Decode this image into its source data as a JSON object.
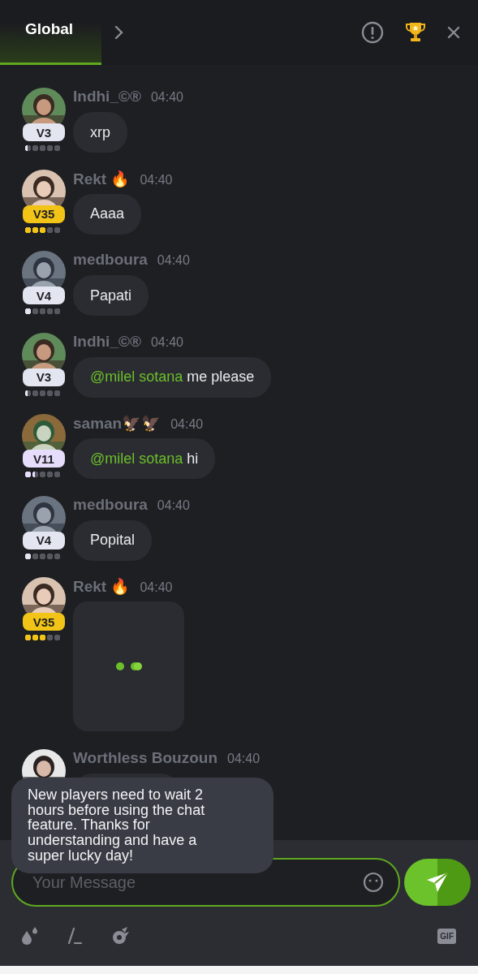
{
  "header": {
    "tab": {
      "label": "Global",
      "selected": true
    }
  },
  "messages": [
    {
      "kind": "text",
      "user": "Indhi_©®",
      "time": "04:40",
      "vip": "V3",
      "color": "#e3e5f0",
      "level": 0.1,
      "text": "xrp"
    },
    {
      "kind": "text",
      "user": "Rekt 🔥",
      "time": "04:40",
      "vip": "V35",
      "color": "#f2c417",
      "level": 0.6,
      "text": "Aaaa"
    },
    {
      "kind": "text",
      "user": "medboura",
      "time": "04:40",
      "vip": "V4",
      "color": "#e3e5f0",
      "level": 0.2,
      "text": "Papati"
    },
    {
      "kind": "text",
      "user": "Indhi_©®",
      "time": "04:40",
      "vip": "V3",
      "color": "#e3e5f0",
      "level": 0.1,
      "mention": "@milel sotana",
      "text": "me please"
    },
    {
      "kind": "text",
      "user": "saman🦅🦅",
      "time": "04:40",
      "vip": "V11",
      "color": "#e6dcfb",
      "level": 0.3,
      "mention": "@milel sotana",
      "text": "hi"
    },
    {
      "kind": "text",
      "user": "medboura",
      "time": "04:40",
      "vip": "V4",
      "color": "#e3e5f0",
      "level": 0.2,
      "text": "Popital"
    },
    {
      "kind": "loading",
      "user": "Rekt 🔥",
      "time": "04:40",
      "vip": "V35",
      "color": "#f2c417",
      "level": 0.6
    },
    {
      "kind": "covered",
      "user": "Worthless Bouzoun",
      "time": "04:40"
    }
  ],
  "notice": {
    "text": "New players need to wait 2 hours before using the chat feature. Thanks for understanding and have a super lucky day!"
  },
  "composer": {
    "placeholder": "Your Message"
  },
  "toolbar": {
    "gif": "GIF"
  }
}
